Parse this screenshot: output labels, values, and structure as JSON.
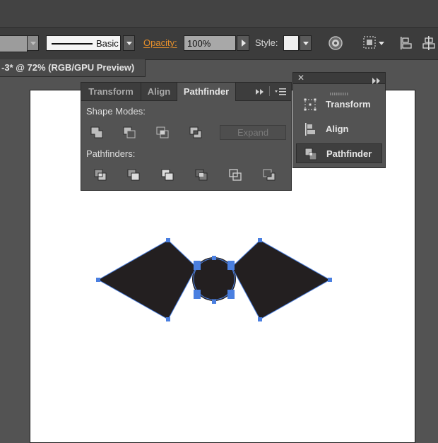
{
  "control_bar": {
    "stroke_style": "Basic",
    "opacity_label": "Opacity:",
    "opacity_value": "100%",
    "style_label": "Style:",
    "icons": [
      "recolor-icon",
      "align-to-selection-icon",
      "align-left-icon",
      "align-center-icon"
    ]
  },
  "document_tab": {
    "title": "-3* @ 72% (RGB/GPU Preview)"
  },
  "pathfinder_panel": {
    "tabs": [
      "Transform",
      "Align",
      "Pathfinder"
    ],
    "active_tab": "Pathfinder",
    "shape_modes_label": "Shape Modes:",
    "shape_modes": [
      "unite-icon",
      "minus-front-icon",
      "intersect-icon",
      "exclude-icon"
    ],
    "expand_label": "Expand",
    "pathfinders_label": "Pathfinders:",
    "pathfinders": [
      "divide-icon",
      "trim-icon",
      "merge-icon",
      "crop-icon",
      "outline-icon",
      "minus-back-icon"
    ]
  },
  "dock": {
    "items": [
      {
        "label": "Transform",
        "icon": "transform-icon"
      },
      {
        "label": "Align",
        "icon": "align-icon"
      },
      {
        "label": "Pathfinder",
        "icon": "pathfinder-icon"
      }
    ],
    "active_item": "Pathfinder"
  },
  "colors": {
    "app_background": "#535353",
    "panel": "#535353",
    "panel_header": "#3d3d3d",
    "accent_orange": "#e58f2b",
    "selection_blue": "#4a7fe0",
    "shape_fill": "#231f20"
  }
}
